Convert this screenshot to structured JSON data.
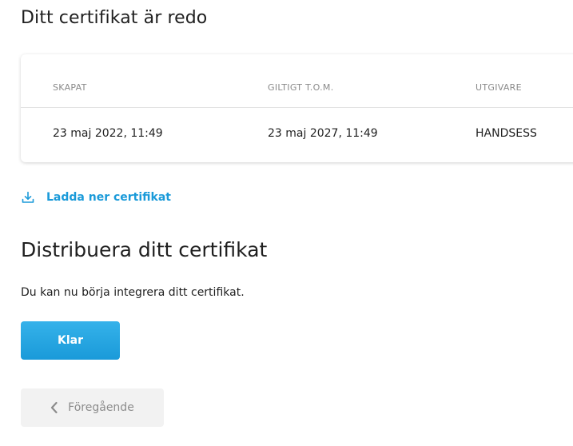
{
  "certificate": {
    "title": "Ditt certifikat är redo",
    "columns": [
      "SKAPAT",
      "GILTIGT T.O.M.",
      "UTGIVARE"
    ],
    "row": [
      "23 maj 2022, 11:49",
      "23 maj 2027, 11:49",
      "HANDSESS"
    ]
  },
  "download": {
    "label": "Ladda ner certifikat",
    "icon": "download-icon"
  },
  "distribute": {
    "title": "Distribuera ditt certifikat",
    "description": "Du kan nu börja integrera ditt certifikat."
  },
  "actions": {
    "done_label": "Klar",
    "previous_label": "Föregående",
    "previous_icon": "chevron-left-icon"
  },
  "colors": {
    "accent": "#1a9ad9",
    "text": "#1f1f1f",
    "muted": "#8a8a8a",
    "secondary_button_bg": "#f2f2f2"
  }
}
